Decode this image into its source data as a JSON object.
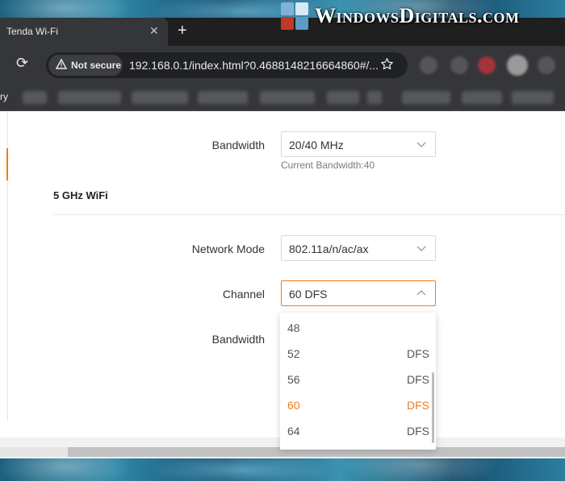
{
  "watermark": {
    "text": "WindowsDigitals.com"
  },
  "browser": {
    "tab_title": "Tenda Wi-Fi",
    "tab_close": "✕",
    "new_tab": "+",
    "reload": "⟳",
    "security_icon": "warning-triangle-icon",
    "security_label": "Not secure",
    "url": "192.168.0.1/index.html?0.4688148216664860#/...",
    "bookmark_fragment": "ry"
  },
  "settings_24": {
    "bandwidth_label": "Bandwidth",
    "bandwidth_value": "20/40 MHz",
    "current_bandwidth": "Current Bandwidth:40"
  },
  "settings_5": {
    "section_title": "5 GHz WiFi",
    "network_mode_label": "Network Mode",
    "network_mode_value": "802.11a/n/ac/ax",
    "channel_label": "Channel",
    "channel_value": "60 DFS",
    "bandwidth_label": "Bandwidth"
  },
  "channel_options": [
    {
      "channel": "48",
      "tag": ""
    },
    {
      "channel": "52",
      "tag": "DFS"
    },
    {
      "channel": "56",
      "tag": "DFS"
    },
    {
      "channel": "60",
      "tag": "DFS",
      "selected": true
    },
    {
      "channel": "64",
      "tag": "DFS"
    }
  ],
  "colors": {
    "accent": "#f07d1b",
    "browser_chrome": "#35363a",
    "text": "#333333"
  }
}
